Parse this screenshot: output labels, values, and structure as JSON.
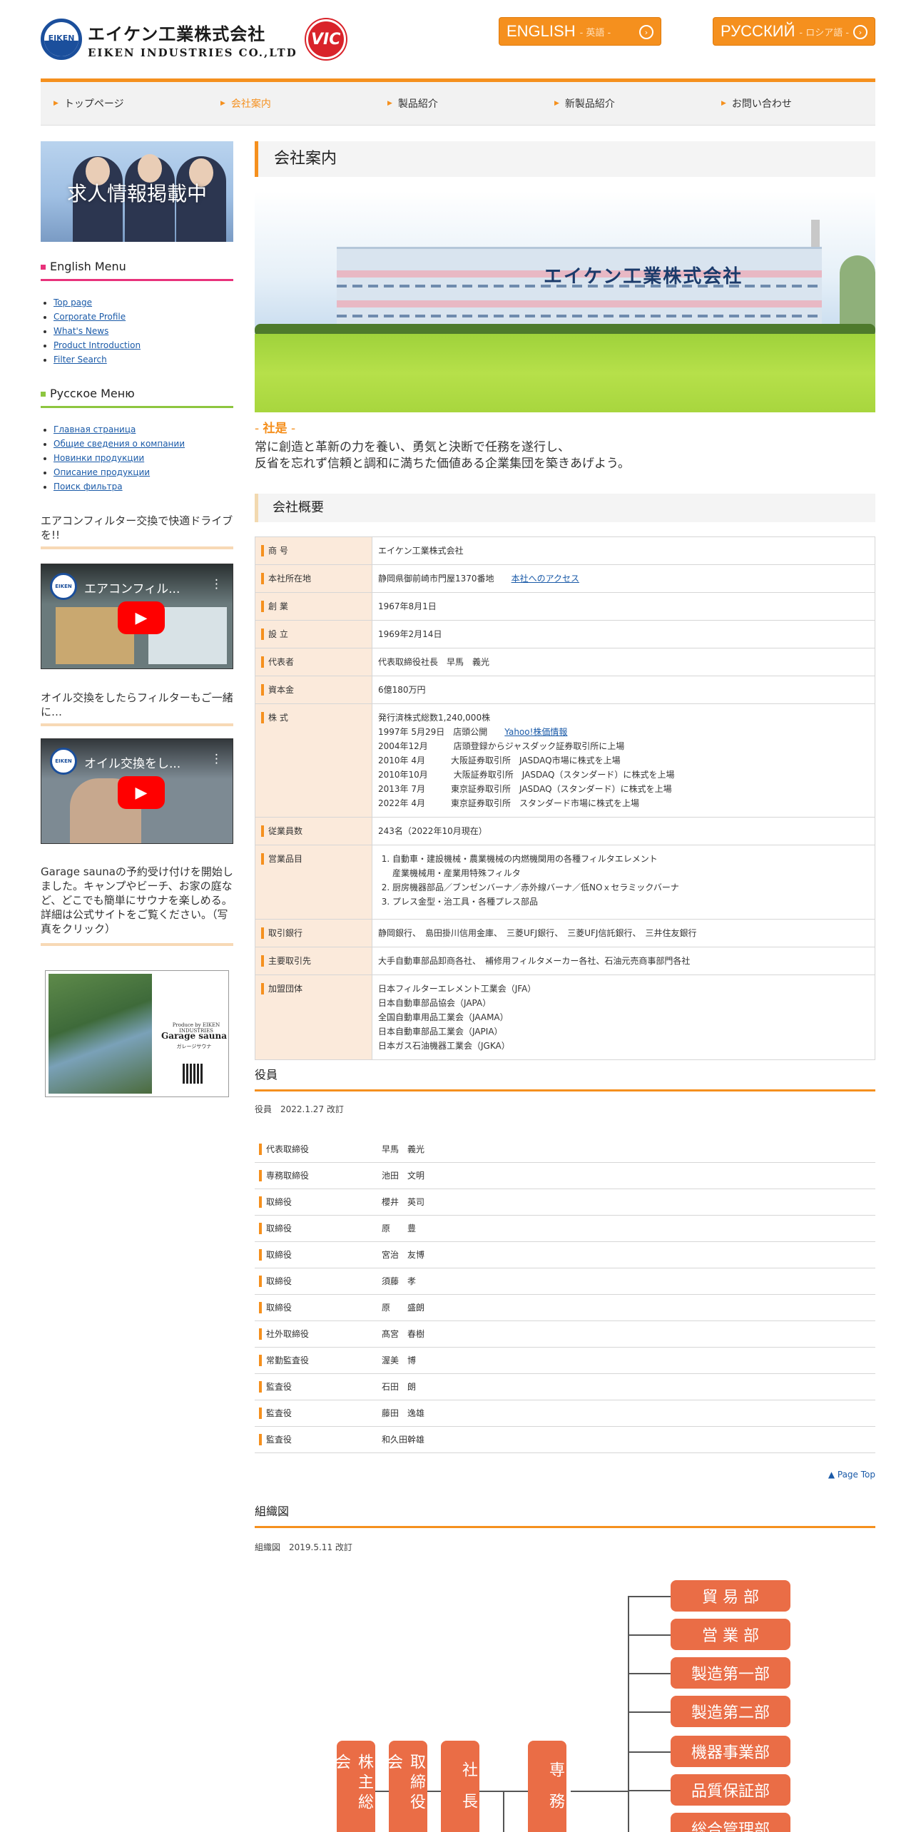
{
  "header": {
    "logo_mark": "EIKEN",
    "logo_jp": "エイケン工業株式会社",
    "logo_en": "EIKEN INDUSTRIES CO.,LTD",
    "vic": "VIC",
    "english_btn": {
      "big": "ENGLISH",
      "small": "- 英語 -"
    },
    "russian_btn": {
      "big": "РУССКИЙ",
      "small": "- ロシア語 -"
    }
  },
  "nav": [
    "トップページ",
    "会社案内",
    "製品紹介",
    "新製品紹介",
    "お問い合わせ"
  ],
  "sidebar": {
    "banner": "求人情報掲載中",
    "english_menu": {
      "title": "English Menu",
      "items": [
        "Top page",
        "Corporate Profile",
        "What's News",
        "Product Introduction",
        "Filter Search"
      ]
    },
    "russian_menu": {
      "title": "Русское Меню",
      "items": [
        "Главная страница",
        "Общие сведения о компании",
        "Новинки продукции",
        "Описание продукции",
        "Поиск фильтра"
      ]
    },
    "video1_caption": "エアコンフィルター交換で快適ドライブを!!",
    "video1_title": "エアコンフィル...",
    "video2_caption": "オイル交換をしたらフィルターもご一緒に…",
    "video2_title": "オイル交換をし...",
    "sauna_text": "Garage saunaの予約受け付けを開始しました。キャンプやビーチ、お家の庭など、どこでも簡単にサウナを楽しめる。詳細は公式サイトをご覧ください。（写真をクリック）",
    "sauna_brand": "Garage sauna",
    "sauna_sub": "ガレージサウナ",
    "sauna_producer": "Produce by EIKEN INDUSTRIES"
  },
  "main": {
    "title": "会社案内",
    "factory_sign": "エイケン工業株式会社",
    "motto_label": "社是",
    "motto_line1": "常に創造と革新の力を養い、勇気と決断で任務を遂行し、",
    "motto_line2": "反省を忘れず信頼と調和に満ちた価値ある企業集団を築きあげよう。",
    "overview_title": "会社概要",
    "overview": {
      "shogo": {
        "k": "商 号",
        "v": "エイケン工業株式会社"
      },
      "address": {
        "k": "本社所在地",
        "v": "静岡県御前崎市門屋1370番地",
        "link": "本社へのアクセス"
      },
      "founded": {
        "k": "創 業",
        "v": "1967年8月1日"
      },
      "established": {
        "k": "設 立",
        "v": "1969年2月14日"
      },
      "rep": {
        "k": "代表者",
        "v": "代表取締役社長　早馬　義光"
      },
      "capital": {
        "k": "資本金",
        "v": "6億180万円"
      },
      "stock": {
        "k": "株 式",
        "l1": "発行済株式総数1,240,000株",
        "l2": "1997年 5月29日　店頭公開",
        "l2link": "Yahoo!株価情報",
        "l3": "2004年12月　　　店頭登録からジャスダック証券取引所に上場",
        "l4": "2010年 4月　　　大阪証券取引所　JASDAQ市場に株式を上場",
        "l5": "2010年10月　　　大阪証券取引所　JASDAQ（スタンダード）に株式を上場",
        "l6": "2013年 7月　　　東京証券取引所　JASDAQ（スタンダード）に株式を上場",
        "l7": "2022年 4月　　　東京証券取引所　スタンダード市場に株式を上場"
      },
      "employees": {
        "k": "従業員数",
        "v": "243名（2022年10月現在）"
      },
      "products": {
        "k": "営業品目",
        "i1a": "自動車・建設機械・農業機械の内燃機関用の各種フィルタエレメント",
        "i1b": "産業機械用・産業用特殊フィルタ",
        "i2": "厨房機器部品／ブンゼンバーナ／赤外線バーナ／低NOｘセラミックバーナ",
        "i3": "プレス金型・治工具・各種プレス部品"
      },
      "banks": {
        "k": "取引銀行",
        "v": "静岡銀行、　島田掛川信用金庫、　三菱UFJ銀行、　三菱UFJ信託銀行、　三井住友銀行"
      },
      "clients": {
        "k": "主要取引先",
        "v": "大手自動車部品卸商各社、　補修用フィルタメーカー各社、石油元売商事部門各社"
      },
      "groups": {
        "k": "加盟団体",
        "l1": "日本フィルターエレメント工業会（JFA）",
        "l2": "日本自動車部品協会（JAPA）",
        "l3": "全国自動車用品工業会（JAAMA）",
        "l4": "日本自動車部品工業会（JAPIA）",
        "l5": "日本ガス石油機器工業会（JGKA）"
      }
    },
    "officers_title": "役員",
    "officers_note": "役員　2022.1.27 改訂",
    "officers": [
      {
        "role": "代表取締役",
        "name": "早馬　義光"
      },
      {
        "role": "専務取締役",
        "name": "池田　文明"
      },
      {
        "role": "取締役",
        "name": "櫻井　英司"
      },
      {
        "role": "取締役",
        "name": "原　　豊"
      },
      {
        "role": "取締役",
        "name": "宮治　友博"
      },
      {
        "role": "取締役",
        "name": "須藤　孝"
      },
      {
        "role": "取締役",
        "name": "原　　盛朗"
      },
      {
        "role": "社外取締役",
        "name": "髙宮　春樹"
      },
      {
        "role": "常勤監査役",
        "name": "渥美　博"
      },
      {
        "role": "監査役",
        "name": "石田　朗"
      },
      {
        "role": "監査役",
        "name": "藤田　逸雄"
      },
      {
        "role": "監査役",
        "name": "和久田幹雄"
      }
    ],
    "page_top": "▲ Page Top",
    "org_title": "組織図",
    "org_note": "組織図　2019.5.11 改訂",
    "org_vertical": [
      "株主総会",
      "取締役会",
      "社長",
      "専務"
    ],
    "org_depts": [
      "貿 易 部",
      "営 業 部",
      "製造第一部",
      "製造第二部",
      "機器事業部",
      "品質保証部",
      "総合管理部"
    ]
  },
  "colors": {
    "accent": "#f5901e",
    "org": "#ea6d46",
    "table_key_bg": "#fbeadb"
  }
}
